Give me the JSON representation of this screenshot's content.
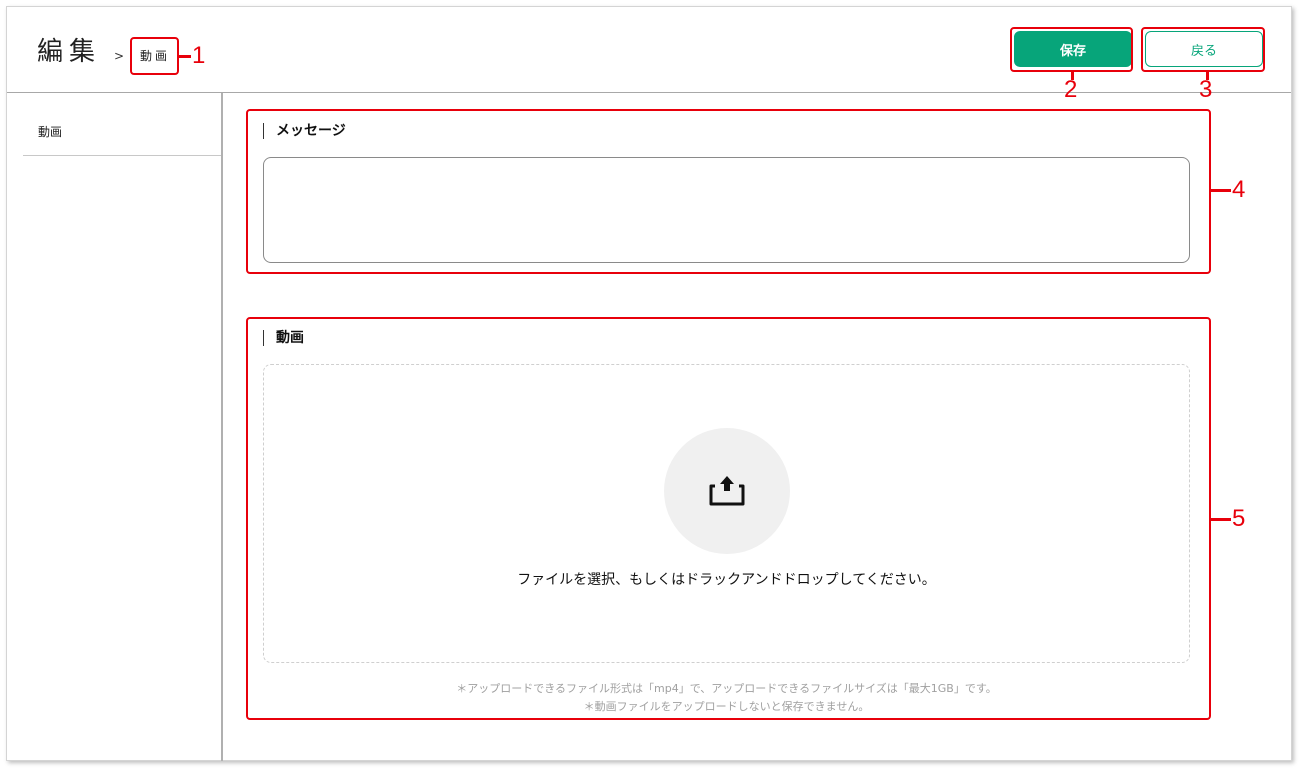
{
  "header": {
    "title": "編集",
    "breadcrumb_separator": ">",
    "breadcrumb_current": "動画",
    "save_label": "保存",
    "back_label": "戻る"
  },
  "sidebar": {
    "items": [
      {
        "label": "動画"
      }
    ]
  },
  "message_section": {
    "label": "メッセージ",
    "value": ""
  },
  "video_section": {
    "label": "動画",
    "drop_text": "ファイルを選択、もしくはドラックアンドドロップしてください。",
    "icon": "upload-icon",
    "notes": [
      "＊アップロードできるファイル形式は「mp4」で、アップロードできるファイルサイズは「最大1GB」です。",
      "＊動画ファイルをアップロードしないと保存できません。"
    ]
  },
  "annotations": [
    "1",
    "2",
    "3",
    "4",
    "5"
  ],
  "colors": {
    "accent": "#07a57a",
    "annotation": "#e8000b"
  }
}
